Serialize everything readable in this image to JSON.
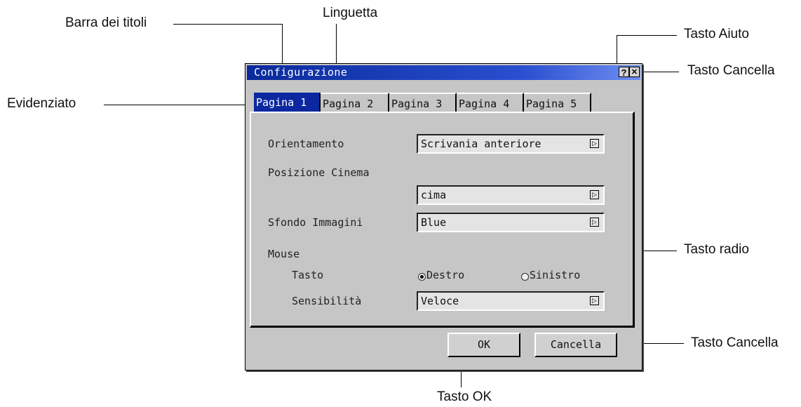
{
  "callouts": {
    "title_bar": "Barra dei titoli",
    "tab": "Linguetta",
    "help_button": "Tasto Aiuto",
    "close_button": "Tasto Cancella",
    "highlighted": "Evidenziato",
    "radio_button": "Tasto radio",
    "cancel_button": "Tasto Cancella",
    "ok_button": "Tasto OK"
  },
  "dialog": {
    "title": "Configurazione",
    "help_glyph": "?",
    "close_glyph": "✕",
    "tabs": [
      {
        "label": "Pagina 1",
        "selected": true
      },
      {
        "label": "Pagina 2",
        "selected": false
      },
      {
        "label": "Pagina 3",
        "selected": false
      },
      {
        "label": "Pagina 4",
        "selected": false
      },
      {
        "label": "Pagina 5",
        "selected": false
      }
    ],
    "fields": {
      "orientation_label": "Orientamento",
      "orientation_value": "Scrivania anteriore",
      "cinema_label": "Posizione Cinema",
      "cinema_value": "cima",
      "background_label": "Sfondo Immagini",
      "background_value": "Blue",
      "mouse_label": "Mouse",
      "button_label": "Tasto",
      "right_option": "Destro",
      "left_option": "Sinistro",
      "sensitivity_label": "Sensibilità",
      "sensitivity_value": "Veloce"
    },
    "buttons": {
      "ok": "OK",
      "cancel": "Cancella"
    }
  },
  "colors": {
    "titlebar": "#0a2a9c",
    "selected_tab": "#0b28a0",
    "dialog_bg": "#c6c6c6"
  }
}
